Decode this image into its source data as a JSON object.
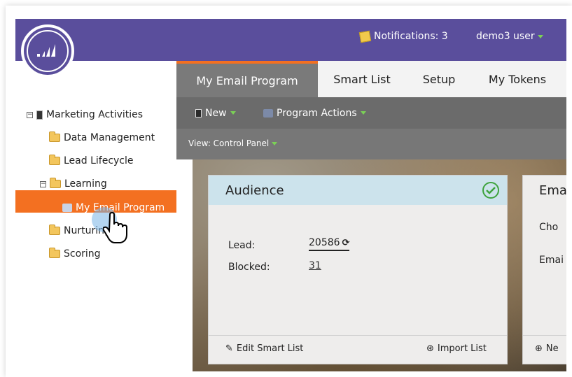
{
  "header": {
    "notifications_label": "Notifications: 3",
    "user_label": "demo3 user"
  },
  "tabs": [
    "My Email Program",
    "Smart List",
    "Setup",
    "My Tokens"
  ],
  "toolbar": {
    "new_label": "New",
    "program_actions_label": "Program Actions"
  },
  "viewbar": {
    "label": "View: Control Panel"
  },
  "tree": {
    "root": "Marketing Activities",
    "data_management": "Data Management",
    "lead_lifecycle": "Lead Lifecycle",
    "learning": "Learning",
    "selected": "My Email Program",
    "nurturing": "Nurturing",
    "scoring": "Scoring"
  },
  "audience_card": {
    "title": "Audience",
    "lead_label": "Lead:",
    "lead_value": "20586",
    "blocked_label": "Blocked:",
    "blocked_value": "31",
    "edit_label": "Edit Smart List",
    "import_label": "Import List"
  },
  "email_card": {
    "title": "Ema",
    "row1": "Cho",
    "row2": "Emai",
    "foot": "Ne"
  },
  "colors": {
    "header": "#5a4e9c",
    "accent": "#f37021",
    "card_header": "#cce3ec",
    "check": "#3ea33e"
  }
}
